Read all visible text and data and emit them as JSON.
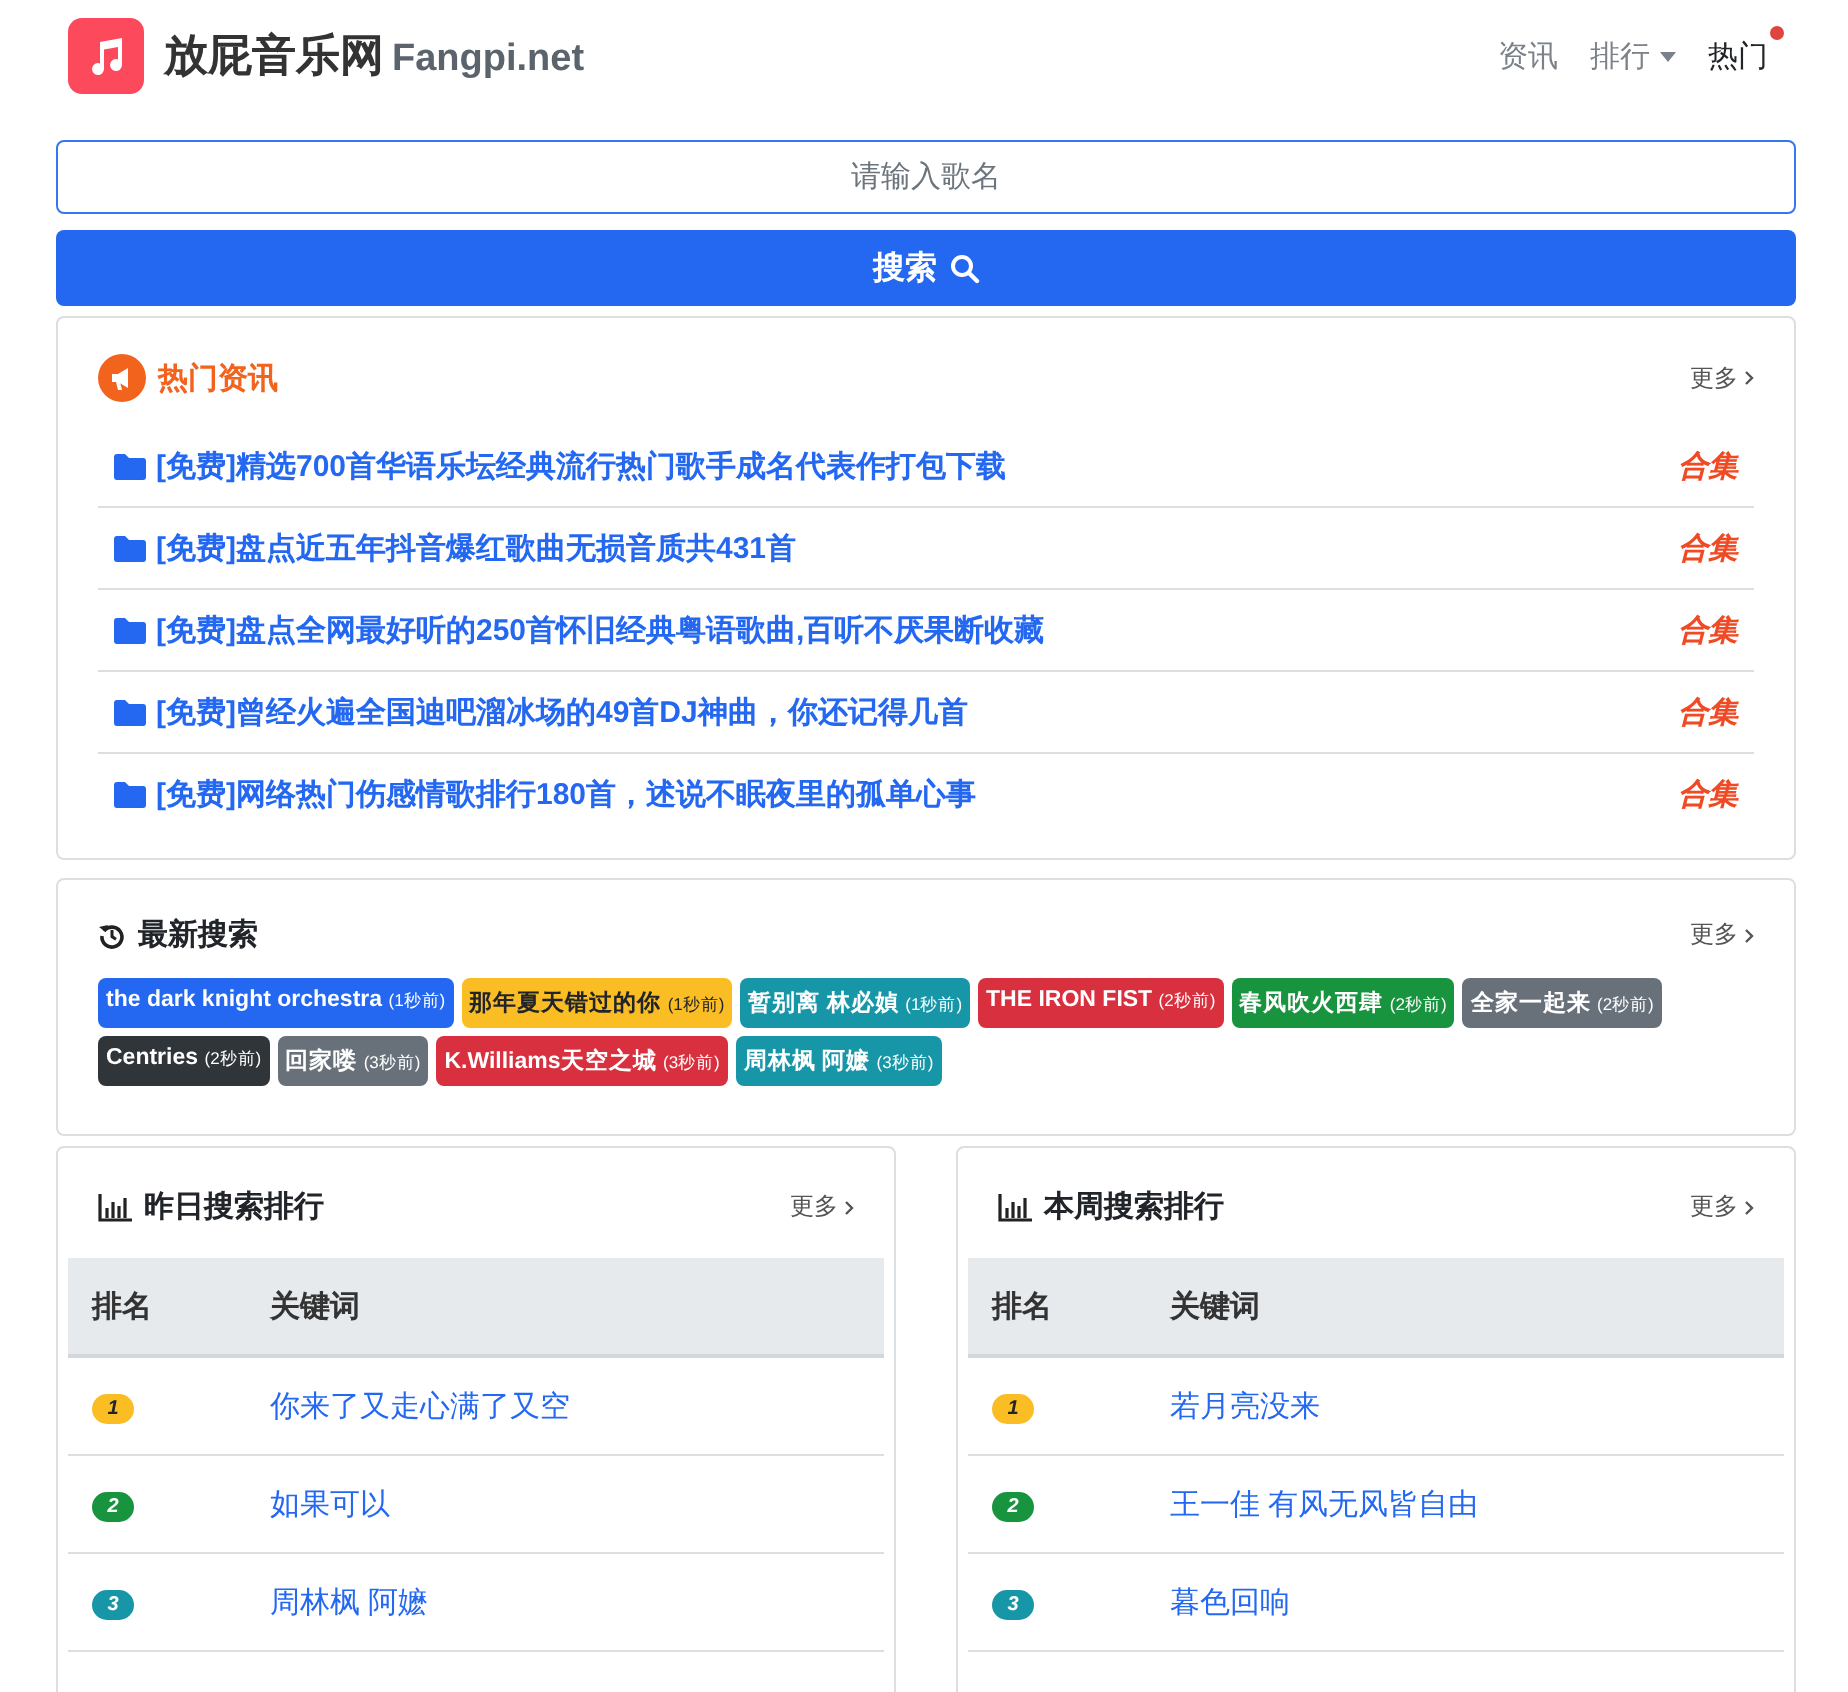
{
  "header": {
    "brand": "放屁音乐网",
    "domain": "Fangpi.net",
    "nav": [
      {
        "label": "资讯",
        "kind": "link",
        "selected": false
      },
      {
        "label": "排行",
        "kind": "dropdown",
        "selected": false
      },
      {
        "label": "热门",
        "kind": "dot",
        "selected": true
      }
    ]
  },
  "search": {
    "placeholder": "请输入歌名",
    "button": "搜索"
  },
  "hot_news": {
    "title": "热门资讯",
    "more": "更多",
    "items": [
      {
        "title": "[免费]精选700首华语乐坛经典流行热门歌手成名代表作打包下载",
        "tag": "合集"
      },
      {
        "title": "[免费]盘点近五年抖音爆红歌曲无损音质共431首",
        "tag": "合集"
      },
      {
        "title": "[免费]盘点全网最好听的250首怀旧经典粤语歌曲,百听不厌果断收藏",
        "tag": "合集"
      },
      {
        "title": "[免费]曾经火遍全国迪吧溜冰场的49首DJ神曲，你还记得几首",
        "tag": "合集"
      },
      {
        "title": "[免费]网络热门伤感情歌排行180首，述说不眠夜里的孤单心事",
        "tag": "合集"
      }
    ]
  },
  "recent_searches": {
    "title": "最新搜索",
    "more": "更多",
    "tags": [
      {
        "keyword": "the dark knight orchestra",
        "time": "(1秒前)",
        "color": "#2468f2"
      },
      {
        "keyword": "那年夏天错过的你",
        "time": "(1秒前)",
        "color": "#fbbd24"
      },
      {
        "keyword": "暂别离 林必媜",
        "time": "(1秒前)",
        "color": "#1796a8"
      },
      {
        "keyword": "THE IRON FIST",
        "time": "(2秒前)",
        "color": "#d8303f"
      },
      {
        "keyword": "春风吹火西肆",
        "time": "(2秒前)",
        "color": "#18943f"
      },
      {
        "keyword": "全家一起来",
        "time": "(2秒前)",
        "color": "#68717a"
      },
      {
        "keyword": "Centries",
        "time": "(2秒前)",
        "color": "#30353a"
      },
      {
        "keyword": "回家喽",
        "time": "(3秒前)",
        "color": "#68717a"
      },
      {
        "keyword": "K.Williams天空之城",
        "time": "(3秒前)",
        "color": "#d8303f"
      },
      {
        "keyword": "周林枫 阿嬷",
        "time": "(3秒前)",
        "color": "#1796a8"
      }
    ]
  },
  "rankings": [
    {
      "title": "昨日搜索排行",
      "more": "更多",
      "columns": [
        "排名",
        "关键词"
      ],
      "rows": [
        {
          "rank": "1",
          "color": "#fbbd24",
          "keyword": "你来了又走心满了又空"
        },
        {
          "rank": "2",
          "color": "#18943f",
          "keyword": "如果可以"
        },
        {
          "rank": "3",
          "color": "#1796a8",
          "keyword": "周林枫 阿嬷"
        }
      ]
    },
    {
      "title": "本周搜索排行",
      "more": "更多",
      "columns": [
        "排名",
        "关键词"
      ],
      "rows": [
        {
          "rank": "1",
          "color": "#fbbd24",
          "keyword": "若月亮没来"
        },
        {
          "rank": "2",
          "color": "#18943f",
          "keyword": "王一佳 有风无风皆自由"
        },
        {
          "rank": "3",
          "color": "#1796a8",
          "keyword": "暮色回响"
        }
      ]
    }
  ]
}
